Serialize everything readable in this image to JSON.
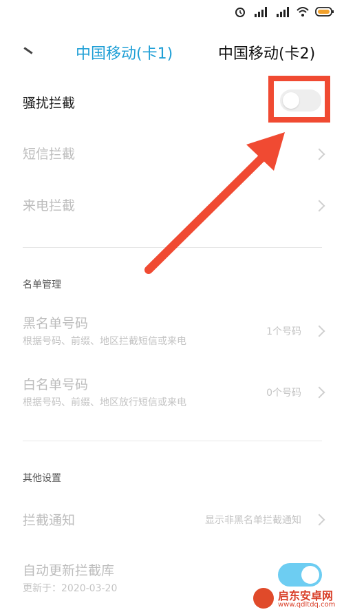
{
  "tabs": [
    {
      "label": "中国移动(卡1)",
      "color": "#1f9fd6"
    },
    {
      "label": "中国移动(卡2)"
    }
  ],
  "rows": {
    "harass": {
      "label": "骚扰拦截",
      "enabled": false
    },
    "sms": {
      "label": "短信拦截"
    },
    "call": {
      "label": "来电拦截"
    }
  },
  "sections": {
    "list_management": "名单管理",
    "other_settings": "其他设置"
  },
  "blacklist": {
    "label": "黑名单号码",
    "sub": "根据号码、前缀、地区拦截短信或来电",
    "value": "1个号码"
  },
  "whitelist": {
    "label": "白名单号码",
    "sub": "根据号码、前缀、地区放行短信或来电",
    "value": "0个号码"
  },
  "notify": {
    "label": "拦截通知",
    "value": "显示非黑名单拦截通知"
  },
  "auto_update": {
    "label": "自动更新拦截库",
    "sub": "更新于：2020-03-20",
    "enabled": true
  },
  "watermark": {
    "name": "启东安卓网",
    "url": "www.qdltdq.com"
  },
  "colors": {
    "accent": "#1f9fd6",
    "annotation": "#f04a32",
    "toggle_on": "#6dcdf2"
  }
}
